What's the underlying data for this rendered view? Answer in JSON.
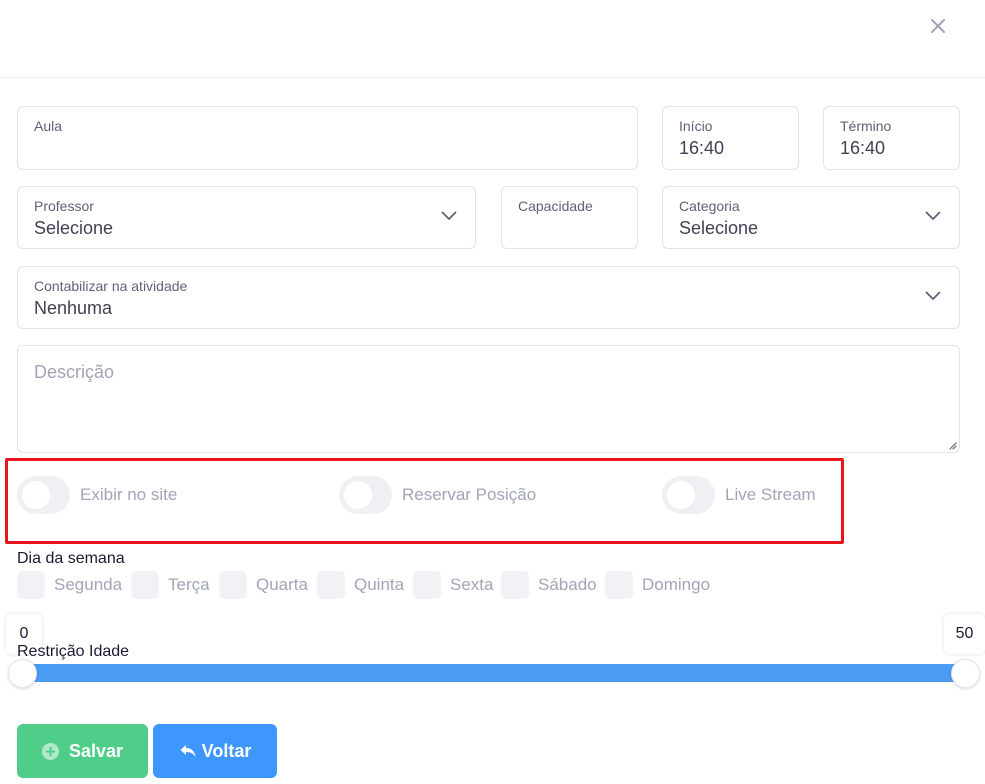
{
  "form": {
    "aula": {
      "label": "Aula",
      "value": ""
    },
    "inicio": {
      "label": "Início",
      "value": "16:40"
    },
    "termino": {
      "label": "Término",
      "value": "16:40"
    },
    "professor": {
      "label": "Professor",
      "value": "Selecione"
    },
    "capacidade": {
      "label": "Capacidade",
      "value": ""
    },
    "categoria": {
      "label": "Categoria",
      "value": "Selecione"
    },
    "contabilizar": {
      "label": "Contabilizar na atividade",
      "value": "Nenhuma"
    },
    "descricao": {
      "placeholder": "Descrição"
    }
  },
  "toggles": [
    {
      "label": "Exibir no site",
      "checked": false
    },
    {
      "label": "Reservar Posição",
      "checked": false
    },
    {
      "label": "Live Stream",
      "checked": false
    }
  ],
  "days": {
    "title": "Dia da semana",
    "items": [
      "Segunda",
      "Terça",
      "Quarta",
      "Quinta",
      "Sexta",
      "Sábado",
      "Domingo"
    ]
  },
  "age_restriction": {
    "title": "Restrição Idade",
    "min": "0",
    "max": "50"
  },
  "buttons": {
    "save": "Salvar",
    "back": "Voltar"
  },
  "colors": {
    "accent": "#3e97ff",
    "success": "#50cd89",
    "highlight": "#e8141b",
    "slider": "#4a9bf3"
  }
}
